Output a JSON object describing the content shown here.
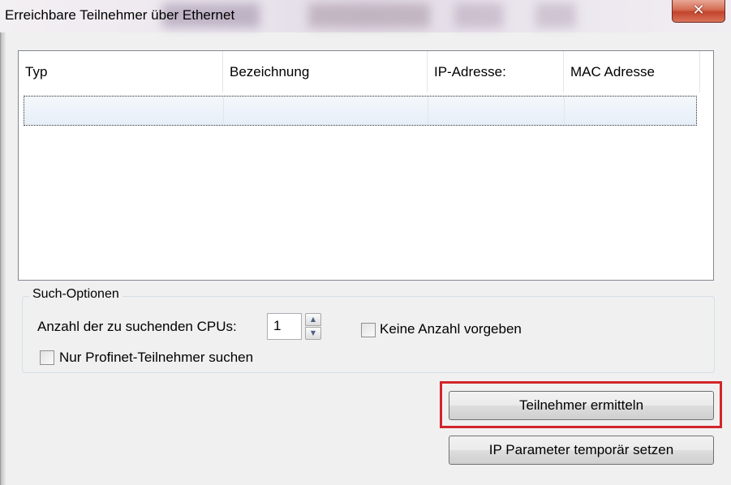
{
  "window": {
    "title": "Erreichbare Teilnehmer über Ethernet",
    "close_glyph": "✕"
  },
  "list": {
    "columns": [
      "Typ",
      "Bezeichnung",
      "IP-Adresse:",
      "MAC Adresse"
    ],
    "rows": [
      [
        "",
        "",
        "",
        ""
      ]
    ]
  },
  "search_options": {
    "legend": "Such-Optionen",
    "cpu_count_label": "Anzahl der zu suchenden CPUs:",
    "cpu_count_value": "1",
    "spin_up_glyph": "▲",
    "spin_down_glyph": "▼",
    "no_count_label": "Keine Anzahl vorgeben",
    "no_count_checked": false,
    "profinet_only_label": "Nur Profinet-Teilnehmer suchen",
    "profinet_only_checked": false
  },
  "buttons": {
    "find": "Teilnehmer ermitteln",
    "set_ip": "IP Parameter temporär setzen"
  },
  "colors": {
    "highlight": "#d1262a",
    "close_button": "#c2432b"
  },
  "icons": {
    "close": "close-icon",
    "spin_up": "arrow-up-icon",
    "spin_down": "arrow-down-icon"
  }
}
